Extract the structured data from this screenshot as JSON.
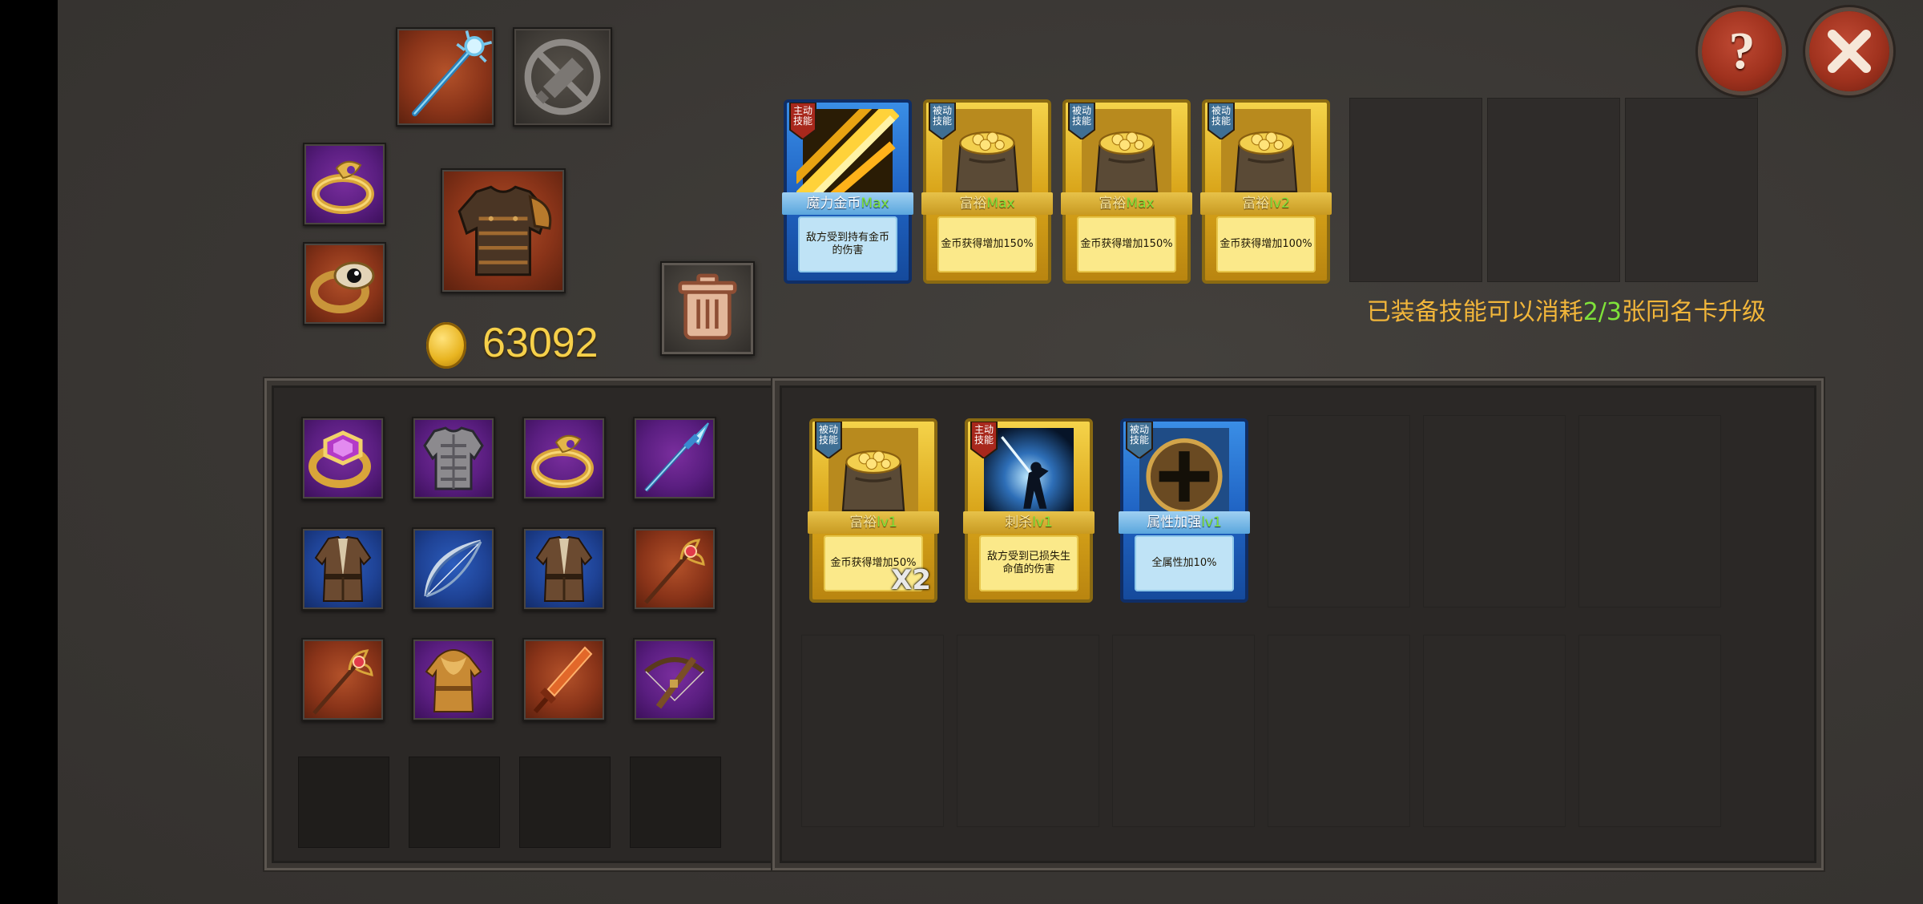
{
  "currency": {
    "icon": "gold-coin-icon",
    "amount": "63092"
  },
  "buttons": {
    "help_label": "?",
    "close_icon": "close-icon",
    "trash_icon": "trash-icon"
  },
  "equipped_gear": {
    "weapon": "ice-staff-icon",
    "offhand_empty": "disabled-sword-icon",
    "ring1": "gold-ring-icon",
    "ring2": "eye-ring-icon",
    "armor": "leather-armor-icon"
  },
  "equipped_skills": [
    {
      "type_tag": "主动\n技能",
      "tag_line1": "主动",
      "tag_line2": "技能",
      "name": "魔力金币",
      "level": "Max",
      "desc": "敌方受到持有金币的伤害",
      "rarity": "blue",
      "art": "lightning-art-icon"
    },
    {
      "type_tag": "被动\n技能",
      "tag_line1": "被动",
      "tag_line2": "技能",
      "name": "富裕",
      "level": "Max",
      "desc": "金币获得增加150%",
      "rarity": "gold",
      "art": "gold-sack-art-icon"
    },
    {
      "type_tag": "被动\n技能",
      "tag_line1": "被动",
      "tag_line2": "技能",
      "name": "富裕",
      "level": "Max",
      "desc": "金币获得增加150%",
      "rarity": "gold",
      "art": "gold-sack-art-icon"
    },
    {
      "type_tag": "被动\n技能",
      "tag_line1": "被动",
      "tag_line2": "技能",
      "name": "富裕",
      "level": "lv2",
      "desc": "金币获得增加100%",
      "rarity": "gold",
      "art": "gold-sack-art-icon"
    }
  ],
  "upgrade_hint": {
    "prefix": "已装备技能可以消耗",
    "count": "2/3",
    "suffix": "张同名卡升级"
  },
  "inventory": [
    "amethyst-ring-icon",
    "iron-armor-icon",
    "gold-ring-icon",
    "spear-icon",
    "cloth-robe-icon",
    "bow-icon",
    "cloth-robe-icon",
    "ruby-staff-icon",
    "ruby-staff-icon",
    "hooded-tunic-icon",
    "flame-sword-icon",
    "crossbow-icon"
  ],
  "skill_cards": [
    {
      "tag_line1": "被动",
      "tag_line2": "技能",
      "name": "富裕",
      "level": "lv1",
      "desc": "金币获得增加50%",
      "rarity": "gold",
      "count": "X2",
      "art": "gold-sack-art-icon"
    },
    {
      "tag_line1": "主动",
      "tag_line2": "技能",
      "name": "刺杀",
      "level": "lv1",
      "desc": "敌方受到已损失生命值的伤害",
      "rarity": "gold",
      "count": "",
      "art": "assassin-art-icon"
    },
    {
      "tag_line1": "被动",
      "tag_line2": "技能",
      "name": "属性加强",
      "level": "lv1",
      "desc": "全属性加10%",
      "rarity": "blue",
      "count": "",
      "art": "plus-emblem-art-icon"
    }
  ],
  "colors": {
    "gold_text": "#f2b63a",
    "green_text": "#7fe23a",
    "background": "#3b3835",
    "panel": "#2b2826"
  }
}
